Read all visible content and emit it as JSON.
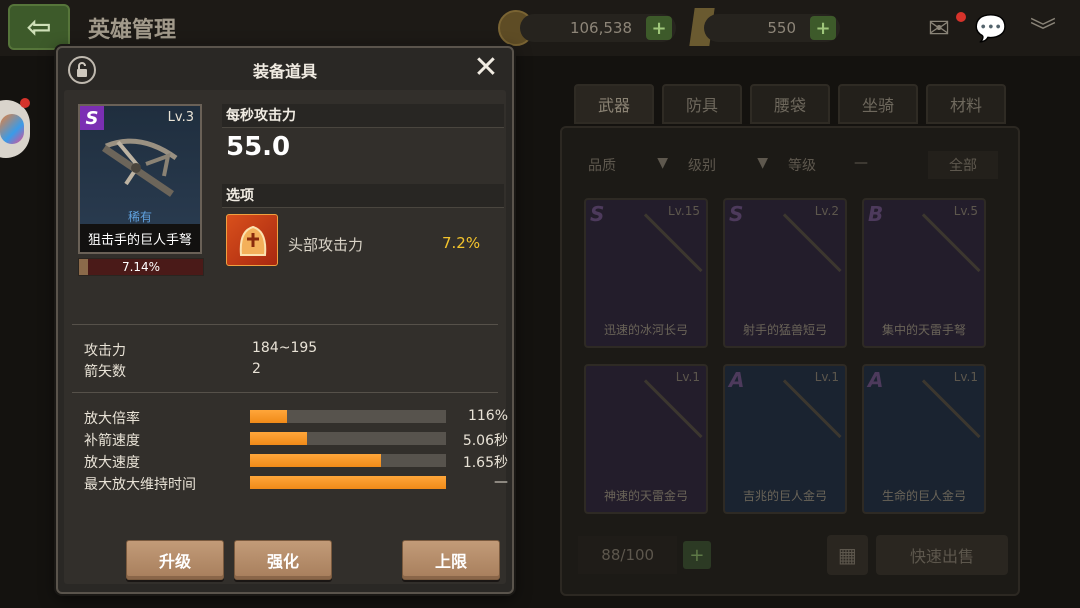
{
  "header": {
    "back_icon": "back-arrow-icon",
    "title": "英雄管理",
    "coins": "106,538",
    "gems": "550",
    "plus": "+"
  },
  "background_panel": {
    "tabs": [
      "武器",
      "防具",
      "腰袋",
      "坐骑",
      "材料"
    ],
    "filters": [
      "品质",
      "级别",
      "等级",
      "—",
      "全部"
    ],
    "items": [
      {
        "grade": "S",
        "level": "Lv.15",
        "name": "迅速的冰河长弓",
        "rarity": "purple"
      },
      {
        "grade": "S",
        "level": "Lv.2",
        "name": "射手的猛兽短弓",
        "rarity": "purple"
      },
      {
        "grade": "B",
        "level": "Lv.5",
        "name": "集中的天雷手弩",
        "rarity": "purple"
      },
      {
        "grade": "",
        "level": "Lv.1",
        "name": "神速的天雷金弓",
        "rarity": "purple"
      },
      {
        "grade": "A",
        "level": "Lv.1",
        "name": "吉兆的巨人金弓",
        "rarity": "blue"
      },
      {
        "grade": "A",
        "level": "Lv.1",
        "name": "生命的巨人金弓",
        "rarity": "blue"
      }
    ],
    "capacity": "88/100",
    "quick_sell": "快速出售"
  },
  "dialog": {
    "title": "装备道具",
    "item": {
      "grade": "S",
      "level": "Lv.3",
      "rarity": "稀有",
      "name": "狙击手的巨人手弩",
      "progress_text": "7.14%",
      "progress": 0.0714
    },
    "dps_label": "每秒攻击力",
    "dps_value": "55.0",
    "option_label": "选项",
    "option": {
      "name": "头部攻击力",
      "value": "7.2%"
    },
    "stats": [
      {
        "key": "攻击力",
        "value": "184~195"
      },
      {
        "key": "箭矢数",
        "value": "2"
      }
    ],
    "bars": [
      {
        "key": "放大倍率",
        "value": "116%",
        "fill": 0.19
      },
      {
        "key": "补箭速度",
        "value": "5.06秒",
        "fill": 0.29
      },
      {
        "key": "放大速度",
        "value": "1.65秒",
        "fill": 0.67
      },
      {
        "key": "最大放大维持时间",
        "value": "—",
        "fill": 1.0
      }
    ],
    "buttons": {
      "upgrade": "升级",
      "enhance": "强化",
      "limit": "上限"
    }
  },
  "colors": {
    "accent_orange": "#f08a18",
    "option_value": "#f4c42c",
    "grade_s": "#7b2fb3",
    "button": "#b48b68"
  }
}
